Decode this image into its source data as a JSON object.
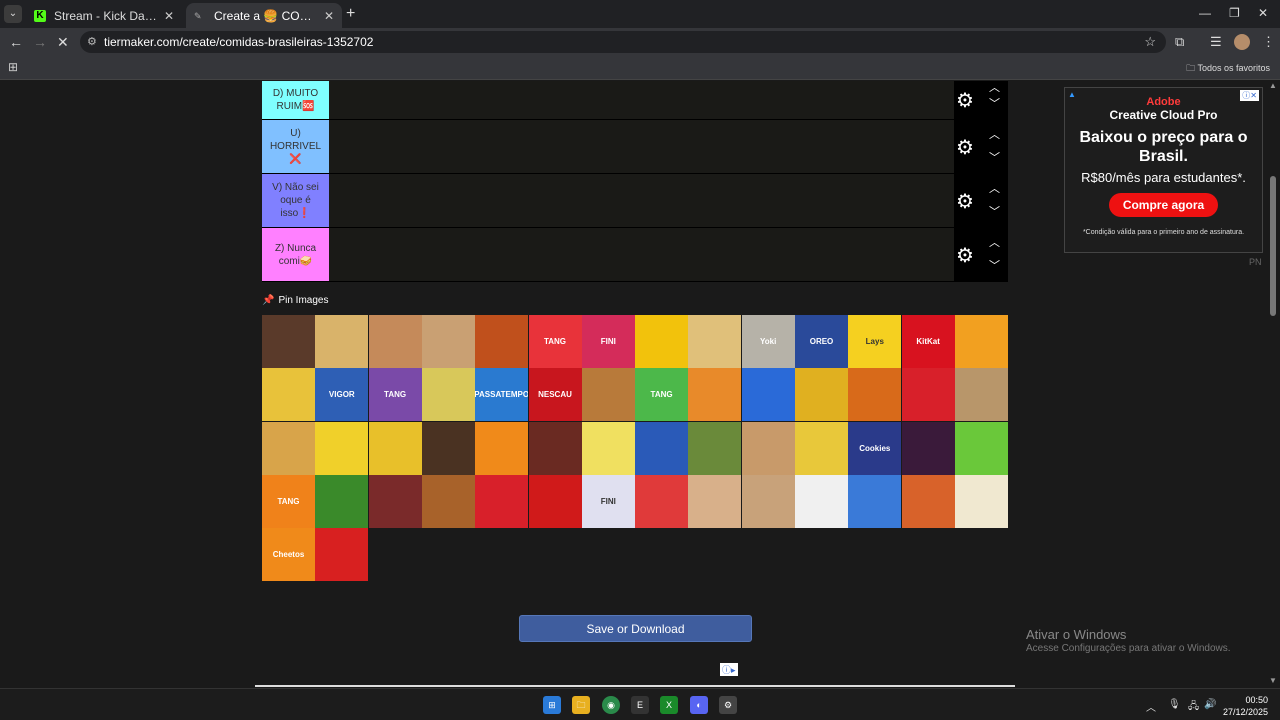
{
  "browser": {
    "tabs": [
      {
        "title": "Stream - Kick Dashboard",
        "active": false
      },
      {
        "title": "Create a 🍔 COMIDAS BRASILEIRAS Tier List",
        "active": true
      }
    ],
    "url": "tiermaker.com/create/comidas-brasileiras-1352702",
    "bookmarks_all": "Todos os favoritos"
  },
  "tiers": [
    {
      "label": "D) MUITO RUIM🆘",
      "color": "#7fffff"
    },
    {
      "label": "U) HORRIVEL ❌",
      "color": "#80c0ff"
    },
    {
      "label": "V) Não sei oque é isso❗",
      "color": "#8080ff"
    },
    {
      "label": "Z) Nunca comi🥪",
      "color": "#ff80ff"
    }
  ],
  "pin_images_label": "Pin Images",
  "images": [
    {
      "name": "farinha",
      "label": "",
      "color": "#5a3a2a"
    },
    {
      "name": "batata",
      "label": "",
      "color": "#d9b36a"
    },
    {
      "name": "pao-de-forma-sausage",
      "label": "",
      "color": "#c58a5a"
    },
    {
      "name": "pao",
      "label": "",
      "color": "#c9a073"
    },
    {
      "name": "macarrao",
      "label": "",
      "color": "#c0501c"
    },
    {
      "name": "tang-morango",
      "label": "TANG",
      "color": "#e8333a"
    },
    {
      "name": "fini",
      "label": "FINI",
      "color": "#d42c5a"
    },
    {
      "name": "miojo",
      "label": "",
      "color": "#f2c20c"
    },
    {
      "name": "lamen",
      "label": "",
      "color": "#e0c07a"
    },
    {
      "name": "yoki",
      "label": "Yoki",
      "color": "#b6b2a8"
    },
    {
      "name": "oreo",
      "label": "OREO",
      "color": "#2a4a9a"
    },
    {
      "name": "lays",
      "label": "Lays",
      "color": "#f5d020"
    },
    {
      "name": "kitkat",
      "label": "KitKat",
      "color": "#d8121f"
    },
    {
      "name": "manga",
      "label": "",
      "color": "#f2a020"
    },
    {
      "name": "sazon",
      "label": "",
      "color": "#e8c23a"
    },
    {
      "name": "vigor",
      "label": "VIGOR",
      "color": "#2e5fb5"
    },
    {
      "name": "tang-uva",
      "label": "TANG",
      "color": "#7a4aa8"
    },
    {
      "name": "pera",
      "label": "",
      "color": "#d8c85a"
    },
    {
      "name": "passatempo",
      "label": "PASSATEMPO",
      "color": "#2a7ad0"
    },
    {
      "name": "nescau",
      "label": "NESCAU",
      "color": "#c8161e"
    },
    {
      "name": "hamburguer",
      "label": "",
      "color": "#b87a3a"
    },
    {
      "name": "tang-limao",
      "label": "TANG",
      "color": "#4cb84a"
    },
    {
      "name": "mamao",
      "label": "",
      "color": "#e88a2a"
    },
    {
      "name": "salgadinho",
      "label": "",
      "color": "#2a6ad8"
    },
    {
      "name": "abacaxi",
      "label": "",
      "color": "#e0b020"
    },
    {
      "name": "abobora",
      "label": "",
      "color": "#d86a1a"
    },
    {
      "name": "mm-bag",
      "label": "",
      "color": "#d8202a"
    },
    {
      "name": "aveia",
      "label": "",
      "color": "#b8966a"
    },
    {
      "name": "queijo",
      "label": "",
      "color": "#d8a44a"
    },
    {
      "name": "banana",
      "label": "",
      "color": "#f0d02a"
    },
    {
      "name": "batata-frita",
      "label": "",
      "color": "#e8c02a"
    },
    {
      "name": "brigadeiro",
      "label": "",
      "color": "#4a3222"
    },
    {
      "name": "tangerina",
      "label": "",
      "color": "#f08a1a"
    },
    {
      "name": "carne",
      "label": "",
      "color": "#6a2a22"
    },
    {
      "name": "melao",
      "label": "",
      "color": "#f0e060"
    },
    {
      "name": "sucrilhos",
      "label": "",
      "color": "#2a5ab8"
    },
    {
      "name": "chimarrao",
      "label": "",
      "color": "#6a8a3a"
    },
    {
      "name": "cookies",
      "label": "",
      "color": "#c89a6a"
    },
    {
      "name": "milho",
      "label": "",
      "color": "#e8c83a"
    },
    {
      "name": "cookies-pacote",
      "label": "Cookies",
      "color": "#2a3a8a"
    },
    {
      "name": "jabuticaba",
      "label": "",
      "color": "#3a1a3a"
    },
    {
      "name": "alface",
      "label": "",
      "color": "#6ac83a"
    },
    {
      "name": "tang-laranja",
      "label": "TANG",
      "color": "#f0821a"
    },
    {
      "name": "ervilha",
      "label": "",
      "color": "#3a8a2a"
    },
    {
      "name": "feijao",
      "label": "",
      "color": "#7a2a2a"
    },
    {
      "name": "frango",
      "label": "",
      "color": "#a8622a"
    },
    {
      "name": "morango",
      "label": "",
      "color": "#d8202a"
    },
    {
      "name": "maca",
      "label": "",
      "color": "#d01a1a"
    },
    {
      "name": "fini-2",
      "label": "FINI",
      "color": "#e0e0f0"
    },
    {
      "name": "melancia",
      "label": "",
      "color": "#e03a3a"
    },
    {
      "name": "ovo",
      "label": "",
      "color": "#d8b08a"
    },
    {
      "name": "biscoito",
      "label": "",
      "color": "#c8a27a"
    },
    {
      "name": "pirulito",
      "label": "",
      "color": "#f0f0f0"
    },
    {
      "name": "mms",
      "label": "",
      "color": "#3a7ad8"
    },
    {
      "name": "pizza",
      "label": "",
      "color": "#d8622a"
    },
    {
      "name": "pipoca",
      "label": "",
      "color": "#f0e8d0"
    },
    {
      "name": "cheetos",
      "label": "Cheetos",
      "color": "#f08a1a"
    },
    {
      "name": "tomate",
      "label": "",
      "color": "#d82020"
    }
  ],
  "save_button": "Save or Download",
  "ad": {
    "brand": "Adobe",
    "product": "Creative Cloud Pro",
    "headline": "Baixou o preço para o Brasil.",
    "price": "R$80/mês para estudantes*.",
    "cta": "Compre agora",
    "note": "*Condição válida para o primeiro ano de assinatura.",
    "side_label": "PN"
  },
  "windows_activation": {
    "title": "Ativar o Windows",
    "subtitle": "Acesse Configurações para ativar o Windows."
  },
  "taskbar": {
    "time": "00:50",
    "date": "27/12/2025"
  }
}
